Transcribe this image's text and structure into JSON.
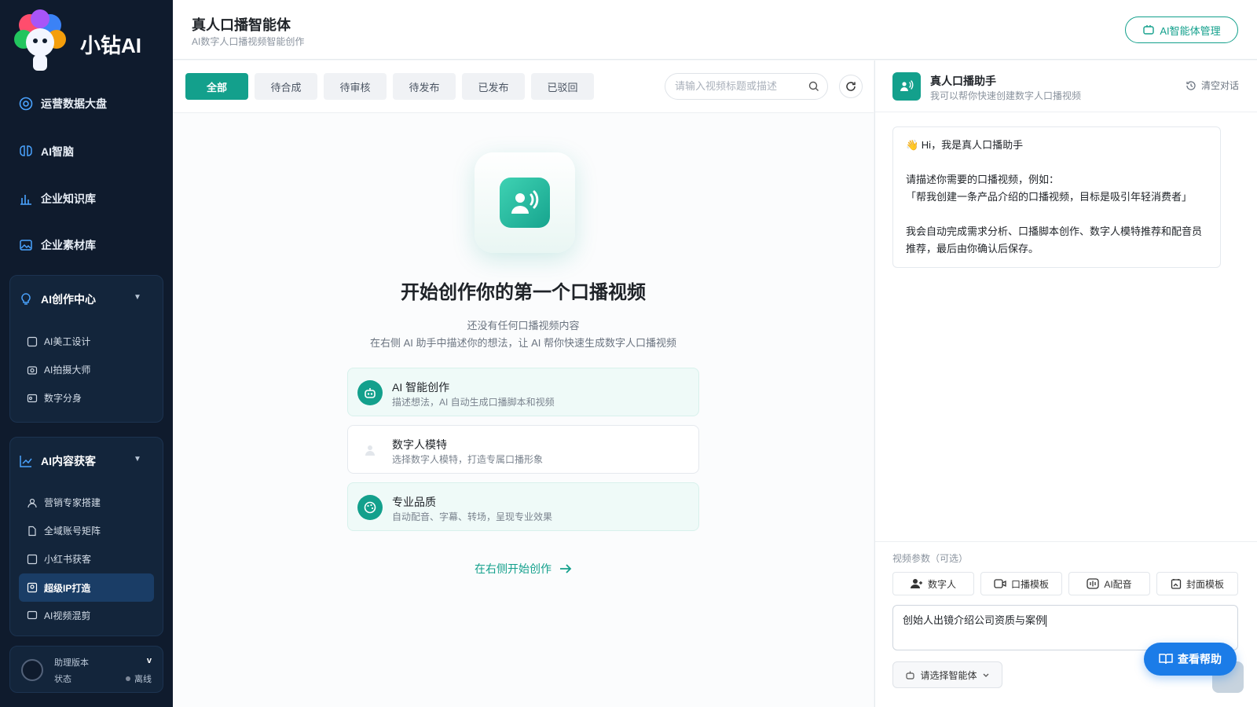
{
  "brand": {
    "name": "小钻AI"
  },
  "sidebar": {
    "items": [
      {
        "label": "运营数据大盘",
        "icon": "dashboard-icon"
      },
      {
        "label": "AI智脑",
        "icon": "brain-icon"
      },
      {
        "label": "企业知识库",
        "icon": "chart-icon"
      },
      {
        "label": "企业素材库",
        "icon": "image-icon"
      }
    ],
    "group_creation": {
      "label": "AI创作中心",
      "items": [
        "AI美工设计",
        "AI拍摄大师",
        "数字分身"
      ]
    },
    "group_acquire": {
      "label": "AI内容获客",
      "items": [
        "营销专家搭建",
        "全域账号矩阵",
        "小红书获客",
        "超级IP打造",
        "AI视频混剪"
      ],
      "active_index": 3
    },
    "version": {
      "label": "助理版本",
      "value": "v",
      "status_label": "状态",
      "status_value": "离线"
    }
  },
  "header": {
    "title": "真人口播智能体",
    "subtitle": "AI数字人口播视频智能创作",
    "manage_button": "AI智能体管理"
  },
  "tabs": [
    "全部",
    "待合成",
    "待审核",
    "待发布",
    "已发布",
    "已驳回"
  ],
  "active_tab": 0,
  "search": {
    "placeholder": "请输入视频标题或描述"
  },
  "empty": {
    "title": "开始创作你的第一个口播视频",
    "line1": "还没有任何口播视频内容",
    "line2": "在右侧 AI 助手中描述你的想法，让 AI 帮你快速生成数字人口播视频",
    "cards": [
      {
        "title": "AI 智能创作",
        "desc": "描述想法，AI 自动生成口播脚本和视频"
      },
      {
        "title": "数字人模特",
        "desc": "选择数字人模特，打造专属口播形象"
      },
      {
        "title": "专业品质",
        "desc": "自动配音、字幕、转场，呈现专业效果"
      }
    ],
    "link": "在右侧开始创作"
  },
  "assistant": {
    "title": "真人口播助手",
    "subtitle": "我可以帮你快速创建数字人口播视频",
    "clear": "清空对话",
    "msg": {
      "l1": "👋 Hi，我是真人口播助手",
      "l2": "请描述你需要的口播视频，例如：",
      "l3": "「帮我创建一条产品介绍的口播视频，目标是吸引年轻消费者」",
      "l4": "我会自动完成需求分析、口播脚本创作、数字人模特推荐和配音员推荐，最后由你确认后保存。"
    },
    "params_label": "视频参数（可选）",
    "param_buttons": [
      "数字人",
      "口播模板",
      "AI配音",
      "封面模板"
    ],
    "input_value": "创始人出镜介绍公司资质与案例",
    "agent_select": "请选择智能体",
    "help": "查看帮助"
  },
  "colors": {
    "accent": "#13a08c",
    "sidebar_bg": "#0f1b2d",
    "help": "#1b7ce8"
  }
}
